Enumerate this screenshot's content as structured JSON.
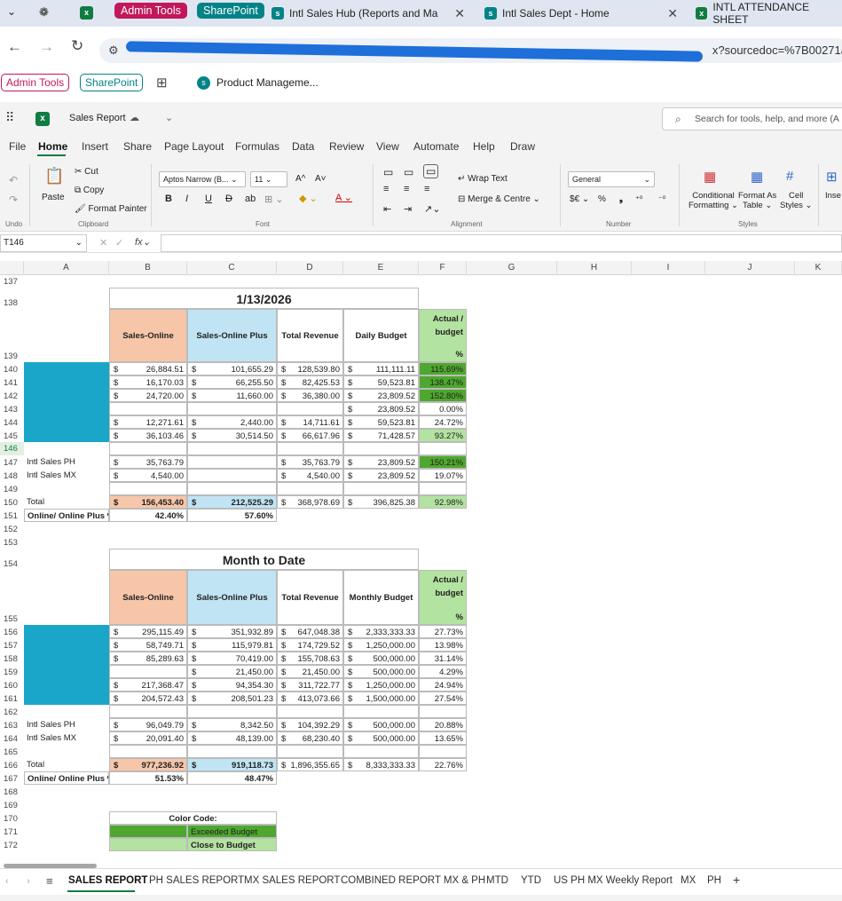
{
  "browser": {
    "tabs": [
      {
        "label": "Admin Tools",
        "kind": "pill",
        "color": "#c2185b"
      },
      {
        "label": "SharePoint",
        "kind": "pill",
        "color": "#038387"
      },
      {
        "label": "Intl Sales Hub (Reports and Ma",
        "kind": "tab"
      },
      {
        "label": "Intl Sales Dept - Home",
        "kind": "tab"
      },
      {
        "label": "INTL ATTENDANCE SHEET",
        "kind": "tab"
      }
    ],
    "url": "ing...sourcedoc=%7B00271a",
    "url_tail": "x?sourcedoc=%7B00271a",
    "bookmarks": [
      "Admin Tools",
      "SharePoint",
      "Product Manageme..."
    ]
  },
  "app": {
    "title": "Sales Report",
    "search_placeholder": "Search for tools, help, and more (A"
  },
  "menu": [
    "File",
    "Home",
    "Insert",
    "Share",
    "Page Layout",
    "Formulas",
    "Data",
    "Review",
    "View",
    "Automate",
    "Help",
    "Draw"
  ],
  "ribbon": {
    "undo": "Undo",
    "paste": "Paste",
    "cut": "Cut",
    "copy": "Copy",
    "format_painter": "Format Painter",
    "clipboard": "Clipboard",
    "font_name": "Aptos Narrow (B...",
    "font_size": "11",
    "font": "Font",
    "wrap": "Wrap Text",
    "merge": "Merge & Centre",
    "alignment": "Alignment",
    "number_format": "General",
    "number": "Number",
    "cond1": "Conditional",
    "cond2": "Formatting",
    "fmt1": "Format As",
    "fmt2": "Table",
    "cell1": "Cell",
    "cell2": "Styles",
    "styles": "Styles",
    "insert": "Inse"
  },
  "formula_bar": {
    "name_box": "T146",
    "fx": "fx"
  },
  "columns": [
    "A",
    "B",
    "C",
    "D",
    "E",
    "F",
    "G",
    "H",
    "I",
    "J",
    "K"
  ],
  "rows": [
    "137",
    "138",
    "139",
    "140",
    "141",
    "142",
    "143",
    "144",
    "145",
    "146",
    "147",
    "148",
    "149",
    "150",
    "151",
    "152",
    "153",
    "154",
    "155",
    "156",
    "157",
    "158",
    "159",
    "160",
    "161",
    "162",
    "163",
    "164",
    "165",
    "166",
    "167",
    "168",
    "169",
    "170",
    "171",
    "172"
  ],
  "daily": {
    "date": "1/13/2026",
    "headers": [
      "Sales-Online",
      "Sales-Online Plus",
      "Total Revenue",
      "Daily Budget",
      "Actual / budget",
      "%"
    ],
    "rows": [
      {
        "b": "26,884.51",
        "c": "101,655.29",
        "d": "128,539.80",
        "e": "111,111.11",
        "f": "115.69%",
        "fc": "#4ea72e"
      },
      {
        "b": "16,170.03",
        "c": "66,255.50",
        "d": "82,425.53",
        "e": "59,523.81",
        "f": "138.47%",
        "fc": "#4ea72e"
      },
      {
        "b": "24,720.00",
        "c": "11,660.00",
        "d": "36,380.00",
        "e": "23,809.52",
        "f": "152.80%",
        "fc": "#4ea72e"
      },
      {
        "b": "",
        "c": "",
        "d": "",
        "e": "23,809.52",
        "f": "0.00%",
        "fc": ""
      },
      {
        "b": "12,271.61",
        "c": "2,440.00",
        "d": "14,711.61",
        "e": "59,523.81",
        "f": "24.72%",
        "fc": ""
      },
      {
        "b": "36,103.46",
        "c": "30,514.50",
        "d": "66,617.96",
        "e": "71,428.57",
        "f": "93.27%",
        "fc": "#b3e3a0"
      }
    ],
    "ph": {
      "label": "Intl Sales PH",
      "b": "35,763.79",
      "d": "35,763.79",
      "e": "23,809.52",
      "f": "150.21%"
    },
    "mx": {
      "label": "Intl Sales MX",
      "b": "4,540.00",
      "d": "4,540.00",
      "e": "23,809.52",
      "f": "19.07%"
    },
    "total": {
      "label": "Total",
      "b": "156,453.40",
      "c": "212,525.29",
      "d": "368,978.69",
      "e": "396,825.38",
      "f": "92.98%"
    },
    "pct": {
      "label": "Online/ Online Plus %",
      "b": "42.40%",
      "c": "57.60%"
    }
  },
  "mtd": {
    "title": "Month to Date",
    "headers": [
      "Sales-Online",
      "Sales-Online Plus",
      "Total Revenue",
      "Monthly Budget",
      "Actual / budget",
      "%"
    ],
    "rows": [
      {
        "b": "295,115.49",
        "c": "351,932.89",
        "d": "647,048.38",
        "e": "2,333,333.33",
        "f": "27.73%"
      },
      {
        "b": "58,749.71",
        "c": "115,979.81",
        "d": "174,729.52",
        "e": "1,250,000.00",
        "f": "13.98%"
      },
      {
        "b": "85,289.63",
        "c": "70,419.00",
        "d": "155,708.63",
        "e": "500,000.00",
        "f": "31.14%"
      },
      {
        "b": "",
        "c": "21,450.00",
        "d": "21,450.00",
        "e": "500,000.00",
        "f": "4.29%"
      },
      {
        "b": "217,368.47",
        "c": "94,354.30",
        "d": "311,722.77",
        "e": "1,250,000.00",
        "f": "24.94%"
      },
      {
        "b": "204,572.43",
        "c": "208,501.23",
        "d": "413,073.66",
        "e": "1,500,000.00",
        "f": "27.54%"
      }
    ],
    "ph": {
      "label": "Intl Sales PH",
      "b": "96,049.79",
      "c": "8,342.50",
      "d": "104,392.29",
      "e": "500,000.00",
      "f": "20.88%"
    },
    "mx": {
      "label": "Intl Sales MX",
      "b": "20,091.40",
      "c": "48,139.00",
      "d": "68,230.40",
      "e": "500,000.00",
      "f": "13.65%"
    },
    "total": {
      "label": "Total",
      "b": "977,236.92",
      "c": "919,118.73",
      "d": "1,896,355.65",
      "e": "8,333,333.33",
      "f": "22.76%"
    },
    "pct": {
      "label": "Online/ Online Plus %",
      "b": "51.53%",
      "c": "48.47%"
    }
  },
  "legend": {
    "title": "Color Code:",
    "exceeded": "Exceeded Budget",
    "close": "Close to Budget"
  },
  "currency": "$",
  "sheets": [
    "SALES REPORT",
    "PH SALES REPORT",
    "MX SALES REPORT",
    "COMBINED REPORT MX & PH",
    "MTD",
    "YTD",
    "US PH MX Weekly Report",
    "MX",
    "PH"
  ],
  "colors": {
    "online": "#f7c6a9",
    "plus": "#c1e4f5",
    "green_dark": "#4ea72e",
    "green_light": "#b3e3a0",
    "teal": "#1aa6c9",
    "excel": "#107c41"
  }
}
